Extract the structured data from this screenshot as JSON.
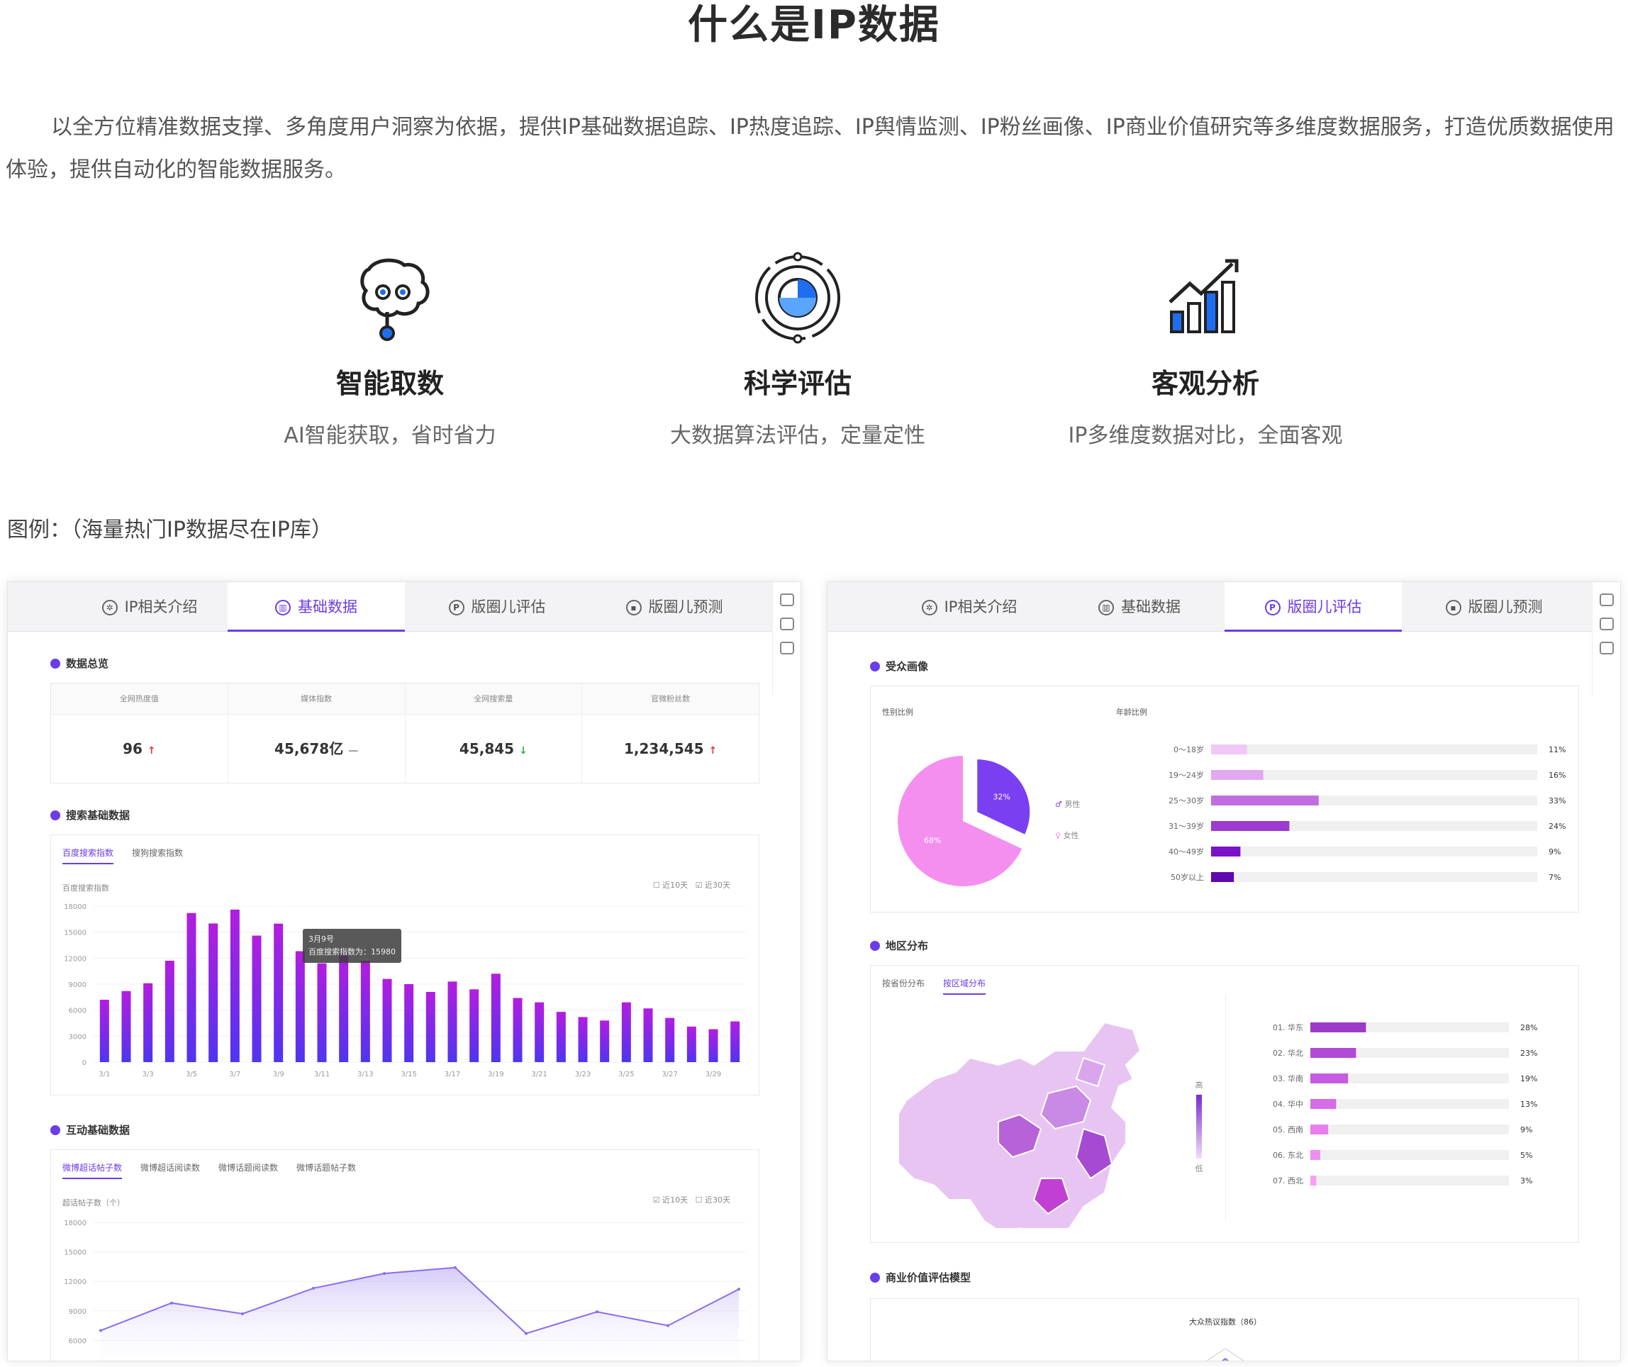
{
  "title": "什么是IP数据",
  "intro": "以全方位精准数据支撑、多角度用户洞察为依据，提供IP基础数据追踪、IP热度追踪、IP舆情监测、IP粉丝画像、IP商业价值研究等多维度数据服务，打造优质数据使用体验，提供自动化的智能数据服务。",
  "features": [
    {
      "title": "智能取数",
      "desc": "AI智能获取，省时省力",
      "icon": "brain-icon"
    },
    {
      "title": "科学评估",
      "desc": "大数据算法评估，定量定性",
      "icon": "target-pie-icon"
    },
    {
      "title": "客观分析",
      "desc": "IP多维度数据对比，全面客观",
      "icon": "growth-chart-icon"
    }
  ],
  "example_label": "图例：（海量热门IP数据尽在IP库）",
  "tabs": [
    "IP相关介绍",
    "基础数据",
    "版圈儿评估",
    "版圈儿预测"
  ],
  "left": {
    "overview_title": "数据总览",
    "stats": [
      {
        "label": "全网热度值",
        "value": "96",
        "trend": "↑"
      },
      {
        "label": "媒体指数",
        "value": "45,678亿",
        "trend": "—"
      },
      {
        "label": "全网搜索量",
        "value": "45,845",
        "trend": "↓"
      },
      {
        "label": "官微粉丝数",
        "value": "1,234,545",
        "trend": "↑"
      }
    ],
    "search_title": "搜索基础数据",
    "search_tabs": [
      "百度搜索指数",
      "搜狗搜索指数"
    ],
    "search_legend": [
      "近10天",
      "近30天"
    ],
    "search_ylabel": "百度搜索指数",
    "tooltip_date": "3月9号",
    "tooltip_text": "百度搜索指数为：15980",
    "interact_title": "互动基础数据",
    "interact_tabs": [
      "微博超话帖子数",
      "微博超话阅读数",
      "微博话题阅读数",
      "微博话题帖子数"
    ],
    "interact_legend": [
      "近10天",
      "近30天"
    ],
    "interact_ylabel": "超话帖子数（个）"
  },
  "right": {
    "audience_title": "受众画像",
    "gender_label": "性别比例",
    "age_label": "年龄比例",
    "male_label": "男性",
    "female_label": "女性",
    "region_title": "地区分布",
    "region_tabs": [
      "按省份分布",
      "按区域分布"
    ],
    "legend_high": "高",
    "legend_low": "低",
    "commercial_title": "商业价值评估模型",
    "radar_label": "大众热议指数（86）"
  },
  "colors": {
    "accent": "#6a3de8",
    "bar_top": "#b31de0",
    "bar_bottom": "#4f35f0",
    "pink": "#f48ff0",
    "purple": "#7b3ff2"
  },
  "chart_data": [
    {
      "type": "bar",
      "title": "",
      "ylabel": "百度搜索指数",
      "ylim": [
        0,
        18000
      ],
      "yticks": [
        0,
        3000,
        6000,
        9000,
        12000,
        15000,
        18000
      ],
      "x_ticks": [
        "3/1",
        "3/3",
        "3/5",
        "3/7",
        "3/9",
        "3/11",
        "3/13",
        "3/15",
        "3/17",
        "3/19",
        "3/21",
        "3/23",
        "3/25",
        "3/27",
        "3/29"
      ],
      "categories": [
        "3/1",
        "3/2",
        "3/3",
        "3/4",
        "3/5",
        "3/6",
        "3/7",
        "3/8",
        "3/9",
        "3/10",
        "3/11",
        "3/12",
        "3/13",
        "3/14",
        "3/15",
        "3/16",
        "3/17",
        "3/18",
        "3/19",
        "3/20",
        "3/21",
        "3/22",
        "3/23",
        "3/24",
        "3/25",
        "3/26",
        "3/27",
        "3/28",
        "3/29",
        "3/30"
      ],
      "values": [
        7200,
        8200,
        9100,
        11700,
        17200,
        16000,
        17600,
        14600,
        15980,
        12800,
        11400,
        12500,
        11700,
        9600,
        9000,
        8100,
        9300,
        8400,
        10200,
        7400,
        6900,
        5800,
        5200,
        4800,
        6900,
        6200,
        5100,
        4100,
        3800,
        4700
      ]
    },
    {
      "type": "line",
      "title": "",
      "ylabel": "超话帖子数（个）",
      "ylim": [
        3000,
        18000
      ],
      "yticks": [
        3000,
        6000,
        9000,
        12000,
        15000,
        18000
      ],
      "values": [
        7000,
        9800,
        8700,
        11300,
        12800,
        13400,
        6700,
        8900,
        7500,
        11200
      ]
    },
    {
      "type": "pie",
      "title": "性别比例",
      "categories": [
        "女性",
        "男性"
      ],
      "values": [
        68,
        32
      ]
    },
    {
      "type": "bar",
      "title": "年龄比例",
      "categories": [
        "0～18岁",
        "19～24岁",
        "25～30岁",
        "31～39岁",
        "40～49岁",
        "50岁以上"
      ],
      "values": [
        11,
        16,
        33,
        24,
        9,
        7
      ],
      "unit": "%"
    },
    {
      "type": "bar",
      "title": "按区域分布",
      "categories": [
        "01. 华东",
        "02. 华北",
        "03. 华南",
        "04. 华中",
        "05. 西南",
        "06. 东北",
        "07. 西北"
      ],
      "values": [
        28,
        23,
        19,
        13,
        9,
        5,
        3
      ],
      "unit": "%"
    }
  ]
}
